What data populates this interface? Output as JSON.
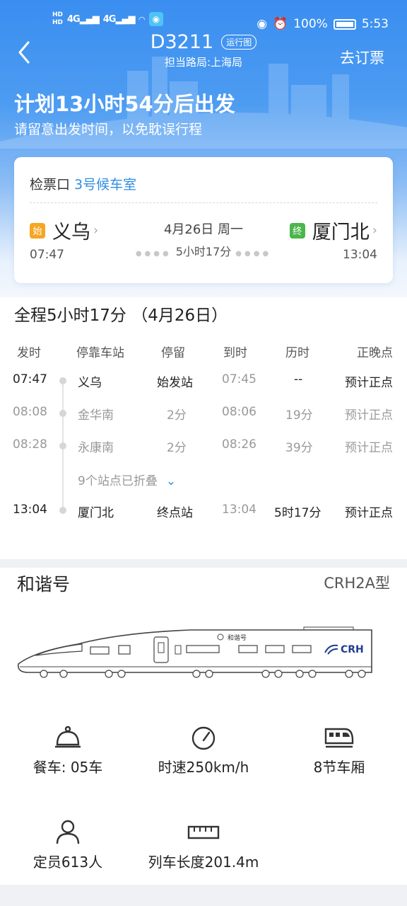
{
  "status_bar": {
    "time": "5:53",
    "battery": "100%",
    "hd1": "HD",
    "hd2": "HD",
    "net1": "4G",
    "net2": "4G"
  },
  "header": {
    "train_no": "D3211",
    "chart_badge": "运行图",
    "bureau": "担当路局:上海局",
    "book_button": "去订票"
  },
  "plan": {
    "title": "计划13小时54分后出发",
    "subtitle": "请留意出发时间，以免耽误行程"
  },
  "card": {
    "gate_label": "检票口",
    "gate_value": "3号候车室",
    "from": {
      "tag": "始",
      "name": "义乌",
      "time": "07:47"
    },
    "to": {
      "tag": "终",
      "name": "厦门北",
      "time": "13:04"
    },
    "date": "4月26日 周一",
    "duration": "5小时17分"
  },
  "schedule": {
    "title": "全程5小时17分 （4月26日）",
    "headers": {
      "dep": "发时",
      "station": "停靠车站",
      "stop": "停留",
      "arr": "到时",
      "elapsed": "历时",
      "punct": "正晚点"
    },
    "rows": [
      {
        "dep": "07:47",
        "station": "义乌",
        "stop": "始发站",
        "arr": "07:45",
        "elapsed": "--",
        "punct": "预计正点"
      },
      {
        "dep": "08:08",
        "station": "金华南",
        "stop": "2分",
        "arr": "08:06",
        "elapsed": "19分",
        "punct": "预计正点"
      },
      {
        "dep": "08:28",
        "station": "永康南",
        "stop": "2分",
        "arr": "08:26",
        "elapsed": "39分",
        "punct": "预计正点"
      },
      {
        "dep": "13:04",
        "station": "厦门北",
        "stop": "终点站",
        "arr": "13:04",
        "elapsed": "5时17分",
        "punct": "预计正点"
      }
    ],
    "folded": "9个站点已折叠"
  },
  "train": {
    "name": "和谐号",
    "model": "CRH2A型",
    "body_text": "和谐号",
    "logo_text": "CRH",
    "features": [
      {
        "icon": "dining-bell-icon",
        "label": "餐车: 05车"
      },
      {
        "icon": "speedometer-icon",
        "label": "时速250km/h"
      },
      {
        "icon": "train-car-icon",
        "label": "8节车厢"
      },
      {
        "icon": "person-icon",
        "label": "定员613人"
      },
      {
        "icon": "ruler-icon",
        "label": "列车长度201.4m"
      }
    ]
  }
}
